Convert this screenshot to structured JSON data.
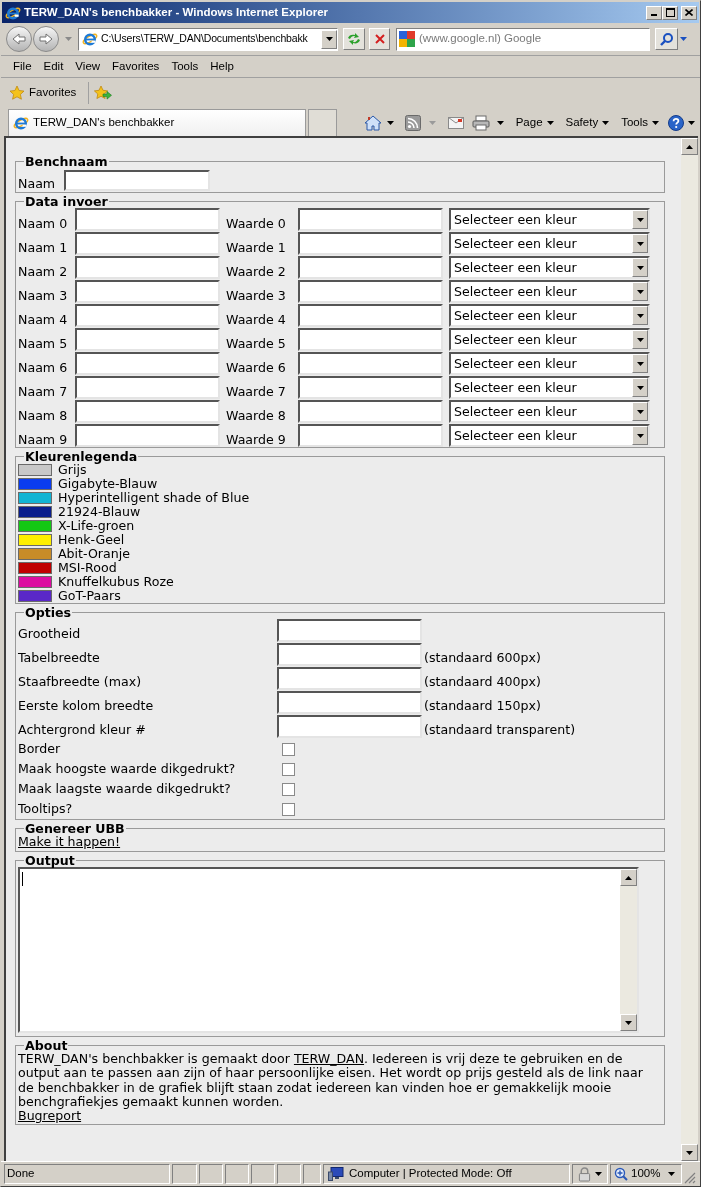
{
  "window": {
    "title": "TERW_DAN's benchbakker - Windows Internet Explorer"
  },
  "address_bar": {
    "value": "C:\\Users\\TERW_DAN\\Documents\\benchbakk",
    "search_placeholder": "(www.google.nl) Google"
  },
  "menu_bar": [
    "File",
    "Edit",
    "View",
    "Favorites",
    "Tools",
    "Help"
  ],
  "favorites_bar": {
    "label": "Favorites"
  },
  "tabs": [
    {
      "label": "TERW_DAN's benchbakker",
      "selected": true
    }
  ],
  "command_bar": [
    "Page",
    "Safety",
    "Tools"
  ],
  "page": {
    "benchnaam": {
      "legend": "Benchnaam",
      "label": "Naam"
    },
    "data_invoer": {
      "legend": "Data invoer",
      "rows": [
        {
          "name_label": "Naam 0",
          "value_label": "Waarde 0",
          "color_select": "Selecteer een kleur"
        },
        {
          "name_label": "Naam 1",
          "value_label": "Waarde 1",
          "color_select": "Selecteer een kleur"
        },
        {
          "name_label": "Naam 2",
          "value_label": "Waarde 2",
          "color_select": "Selecteer een kleur"
        },
        {
          "name_label": "Naam 3",
          "value_label": "Waarde 3",
          "color_select": "Selecteer een kleur"
        },
        {
          "name_label": "Naam 4",
          "value_label": "Waarde 4",
          "color_select": "Selecteer een kleur"
        },
        {
          "name_label": "Naam 5",
          "value_label": "Waarde 5",
          "color_select": "Selecteer een kleur"
        },
        {
          "name_label": "Naam 6",
          "value_label": "Waarde 6",
          "color_select": "Selecteer een kleur"
        },
        {
          "name_label": "Naam 7",
          "value_label": "Waarde 7",
          "color_select": "Selecteer een kleur"
        },
        {
          "name_label": "Naam 8",
          "value_label": "Waarde 8",
          "color_select": "Selecteer een kleur"
        },
        {
          "name_label": "Naam 9",
          "value_label": "Waarde 9",
          "color_select": "Selecteer een kleur"
        }
      ]
    },
    "kleurenlegenda": {
      "legend": "Kleurenlegenda",
      "items": [
        {
          "label": "Grijs",
          "color": "#c8c8c8"
        },
        {
          "label": "Gigabyte-Blauw",
          "color": "#0a3cf0"
        },
        {
          "label": "Hyperintelligent shade of Blue",
          "color": "#12b4d4"
        },
        {
          "label": "21924-Blauw",
          "color": "#0a1e8c"
        },
        {
          "label": "X-Life-groen",
          "color": "#14c814"
        },
        {
          "label": "Henk-Geel",
          "color": "#fff000"
        },
        {
          "label": "Abit-Oranje",
          "color": "#c88c28"
        },
        {
          "label": "MSI-Rood",
          "color": "#c00000"
        },
        {
          "label": "Knuffelkubus Roze",
          "color": "#dc0ca0"
        },
        {
          "label": "GoT-Paars",
          "color": "#5a28c8"
        }
      ]
    },
    "opties": {
      "legend": "Opties",
      "fields": [
        {
          "kind": "text",
          "label": "Grootheid"
        },
        {
          "kind": "text",
          "label": "Tabelbreedte",
          "note": "(standaard 600px)"
        },
        {
          "kind": "text",
          "label": "Staafbreedte (max)",
          "note": "(standaard 400px)"
        },
        {
          "kind": "text",
          "label": "Eerste kolom breedte",
          "note": "(standaard 150px)"
        },
        {
          "kind": "text",
          "label": "Achtergrond kleur #",
          "note": "(standaard transparent)"
        },
        {
          "kind": "checkbox",
          "label": "Border",
          "checked": false
        },
        {
          "kind": "checkbox",
          "label": "Maak hoogste waarde dikgedrukt?",
          "checked": false
        },
        {
          "kind": "checkbox",
          "label": "Maak laagste waarde dikgedrukt?",
          "checked": false
        },
        {
          "kind": "checkbox",
          "label": "Tooltips?",
          "checked": false
        }
      ]
    },
    "genereer_ubb": {
      "legend": "Genereer UBB",
      "link": "Make it happen!"
    },
    "output": {
      "legend": "Output"
    },
    "about": {
      "legend": "About",
      "text_before": "TERW_DAN's benchbakker is gemaakt door ",
      "author_link": "TERW_DAN",
      "text_after": ". Iedereen is vrij deze te gebruiken en de output aan te passen aan zijn of haar persoonlijke eisen. Het wordt op prijs gesteld als de link naar de benchbakker in de grafiek blijft staan zodat iedereen kan vinden hoe er gemakkelijk mooie benchgrafiekjes gemaakt kunnen worden.",
      "bug_link": "Bugreport"
    }
  },
  "status_bar": {
    "status": "Done",
    "zone": "Computer | Protected Mode: Off",
    "zoom": "100%"
  }
}
